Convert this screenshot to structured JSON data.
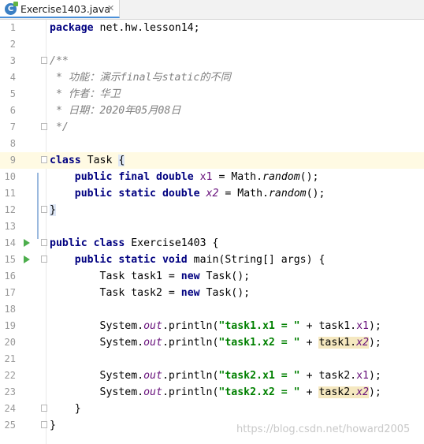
{
  "tab": {
    "label": "Exercise1403.java",
    "close": "✕",
    "icon_letter": "C"
  },
  "lines": {
    "l1": "1",
    "l2": "2",
    "l3": "3",
    "l4": "4",
    "l5": "5",
    "l6": "6",
    "l7": "7",
    "l8": "8",
    "l9": "9",
    "l10": "10",
    "l11": "11",
    "l12": "12",
    "l13": "13",
    "l14": "14",
    "l15": "15",
    "l16": "16",
    "l17": "17",
    "l18": "18",
    "l19": "19",
    "l20": "20",
    "l21": "21",
    "l22": "22",
    "l23": "23",
    "l24": "24",
    "l25": "25"
  },
  "code": {
    "package_kw": "package",
    "package_name": " net.hw.lesson14;",
    "doc_open": "/**",
    "doc_func": " * 功能：演示final与static的不同",
    "doc_author": " * 作者：华卫",
    "doc_date": " * 日期：2020年05月08日",
    "doc_close": " */",
    "class_kw": "class",
    "task_name": " Task ",
    "brace_open": "{",
    "public_kw": "public",
    "final_kw": "final",
    "double_kw": "double",
    "static_kw": "static",
    "x1": "x1",
    "x2": "x2",
    "math_prefix": " = Math.",
    "random": "random",
    "call_end": "();",
    "brace_close": "}",
    "class_name": " Exercise1403 {",
    "void_kw": "void",
    "main_sig": " main(String[] args) {",
    "task1_decl": "Task task1 = ",
    "task2_decl": "Task task2 = ",
    "new_kw": "new",
    "task_ctor": " Task();",
    "system": "System.",
    "out": "out",
    "println": ".println(",
    "s_t1x1": "\"task1.x1 = \"",
    "s_t1x2": "\"task1.x2 = \"",
    "s_t2x1": "\"task2.x1 = \"",
    "s_t2x2": "\"task2.x2 = \"",
    "plus": " + ",
    "task1": "task1.",
    "task2": "task2.",
    "paren_end": ");",
    "inner_close": "}",
    "outer_close": "}"
  },
  "watermark": "https://blog.csdn.net/howard2005",
  "colors": {
    "keyword": "#000080",
    "string": "#008000",
    "comment": "#808080",
    "field": "#660e7a",
    "caret_line": "#fffae3",
    "run_marker": "#4cae4c"
  }
}
